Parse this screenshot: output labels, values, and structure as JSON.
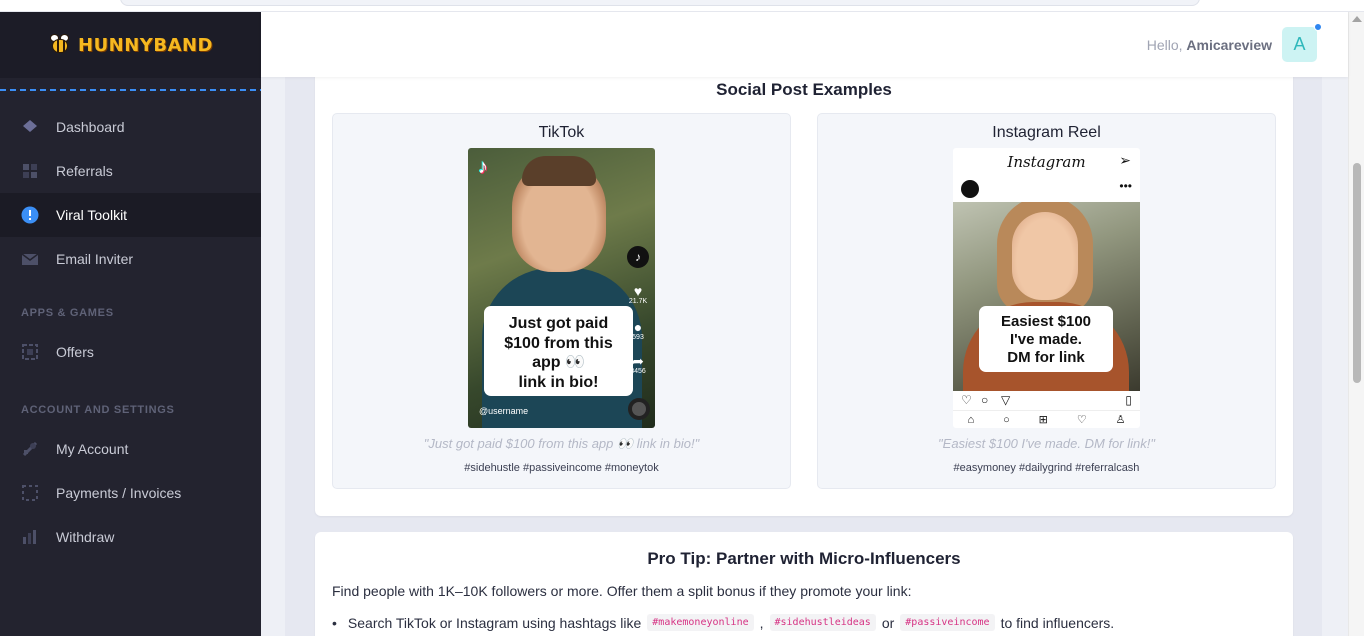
{
  "brand": {
    "name": "HUNNYBAND"
  },
  "header": {
    "greeting": "Hello, ",
    "username": "Amicareview",
    "avatar_letter": "A"
  },
  "sidebar": {
    "items": [
      {
        "label": "Dashboard",
        "icon": "diamond-icon",
        "active": false
      },
      {
        "label": "Referrals",
        "icon": "grid-icon",
        "active": false
      },
      {
        "label": "Viral Toolkit",
        "icon": "alert-circle-icon",
        "active": true
      }
    ],
    "email_item": {
      "label": "Email Inviter",
      "icon": "mail-icon"
    },
    "section_apps": "APPS & GAMES",
    "apps_items": [
      {
        "label": "Offers",
        "icon": "offers-icon"
      }
    ],
    "section_account": "ACCOUNT AND SETTINGS",
    "account_items": [
      {
        "label": "My Account",
        "icon": "account-icon"
      },
      {
        "label": "Payments / Invoices",
        "icon": "invoice-icon"
      },
      {
        "label": "Withdraw",
        "icon": "bar-chart-icon"
      }
    ]
  },
  "social": {
    "title": "Social Post Examples",
    "tiktok": {
      "title": "TikTok",
      "logo": "♪",
      "bubble": "Just got paid $100 from this app 👀 link in bio!",
      "bubble_lines": [
        "Just got paid",
        "$100 from this",
        "app 👀",
        "link in bio!"
      ],
      "likes": "21.7K",
      "comments": "593",
      "shares": "8456",
      "username": "@username",
      "quote": "\"Just got paid $100 from this app 👀 link in bio!\"",
      "tags": "#sidehustle #passiveincome #moneytok"
    },
    "instagram": {
      "title": "Instagram Reel",
      "app_name": "Instagram",
      "bubble_lines": [
        "Easiest $100",
        "I've made.",
        "DM for link"
      ],
      "quote": "\"Easiest $100 I've made. DM for link!\"",
      "tags": "#easymoney #dailygrind #referralcash"
    }
  },
  "tip": {
    "title": "Pro Tip: Partner with Micro-Influencers",
    "text": "Find people with 1K–10K followers or more. Offer them a split bonus if they promote your link:",
    "bullet_prefix": "Search TikTok or Instagram using hashtags like",
    "hashtag_1": "#makemoneyonline",
    "sep_1": ",",
    "hashtag_2": "#sidehustleideas",
    "sep_2": "or",
    "hashtag_3": "#passiveincome",
    "bullet_suffix": "to find influencers."
  },
  "colors": {
    "sidebar_bg": "#23232f",
    "accent_blue": "#3b8ff6",
    "brand_yellow": "#f5b820",
    "avatar_bg": "#cdf3f3"
  }
}
